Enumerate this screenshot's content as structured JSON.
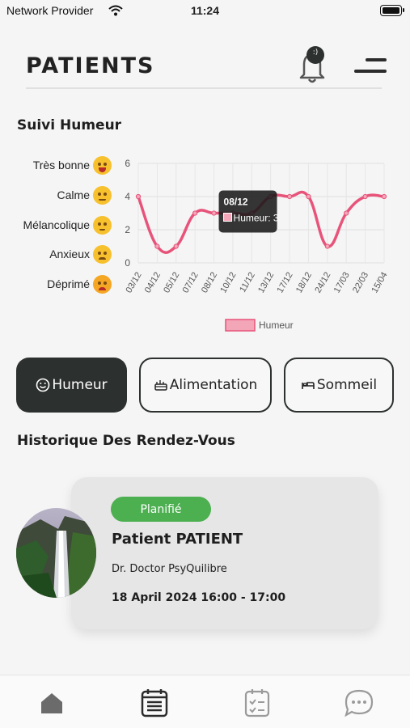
{
  "status_bar": {
    "carrier": "Network Provider",
    "time": "11:24"
  },
  "header": {
    "title": "PATIENTS",
    "notification_badge": ":)"
  },
  "mood_section": {
    "title": "Suivi Humeur",
    "moods": [
      {
        "label": "Très bonne",
        "icon": "grinning-face-icon"
      },
      {
        "label": "Calme",
        "icon": "calm-face-icon"
      },
      {
        "label": "Mélancolique",
        "icon": "melancholic-face-icon"
      },
      {
        "label": "Anxieux",
        "icon": "anxious-face-icon"
      },
      {
        "label": "Déprimé",
        "icon": "depressed-face-icon"
      }
    ]
  },
  "chart_data": {
    "type": "line",
    "x": [
      "03/12",
      "04/12",
      "05/12",
      "07/12",
      "08/12",
      "10/12",
      "11/12",
      "13/12",
      "17/12",
      "18/12",
      "24/12",
      "17/03",
      "22/03",
      "15/04"
    ],
    "series": [
      {
        "name": "Humeur",
        "values": [
          4,
          1,
          1,
          3,
          3,
          3,
          3,
          4,
          4,
          4,
          1,
          3,
          4,
          4
        ],
        "color": "#e8537a"
      }
    ],
    "ylim": [
      0,
      6
    ],
    "yticks": [
      0,
      2,
      4,
      6
    ],
    "grid": true,
    "legend": "bottom",
    "tooltip": {
      "title": "08/12",
      "label": "Humeur: 3",
      "index": 4
    }
  },
  "tabs": [
    {
      "label": "Humeur",
      "icon": "smiley-icon",
      "active": true
    },
    {
      "label": "Alimentation",
      "icon": "food-icon",
      "active": false
    },
    {
      "label": "Sommeil",
      "icon": "bed-icon",
      "active": false
    }
  ],
  "appointments": {
    "title": "Historique Des Rendez-Vous",
    "items": [
      {
        "status": "Planifié",
        "patient": "Patient PATIENT",
        "doctor": "Dr. Doctor PsyQuilibre",
        "datetime": "18 April 2024 16:00 - 17:00",
        "status_color": "#4caf50"
      }
    ]
  },
  "bottom_nav": [
    "home-icon",
    "calendar-icon",
    "checklist-icon",
    "chat-icon"
  ],
  "colors": {
    "dark": "#2c302e",
    "accent": "#e8537a",
    "success": "#4caf50"
  }
}
